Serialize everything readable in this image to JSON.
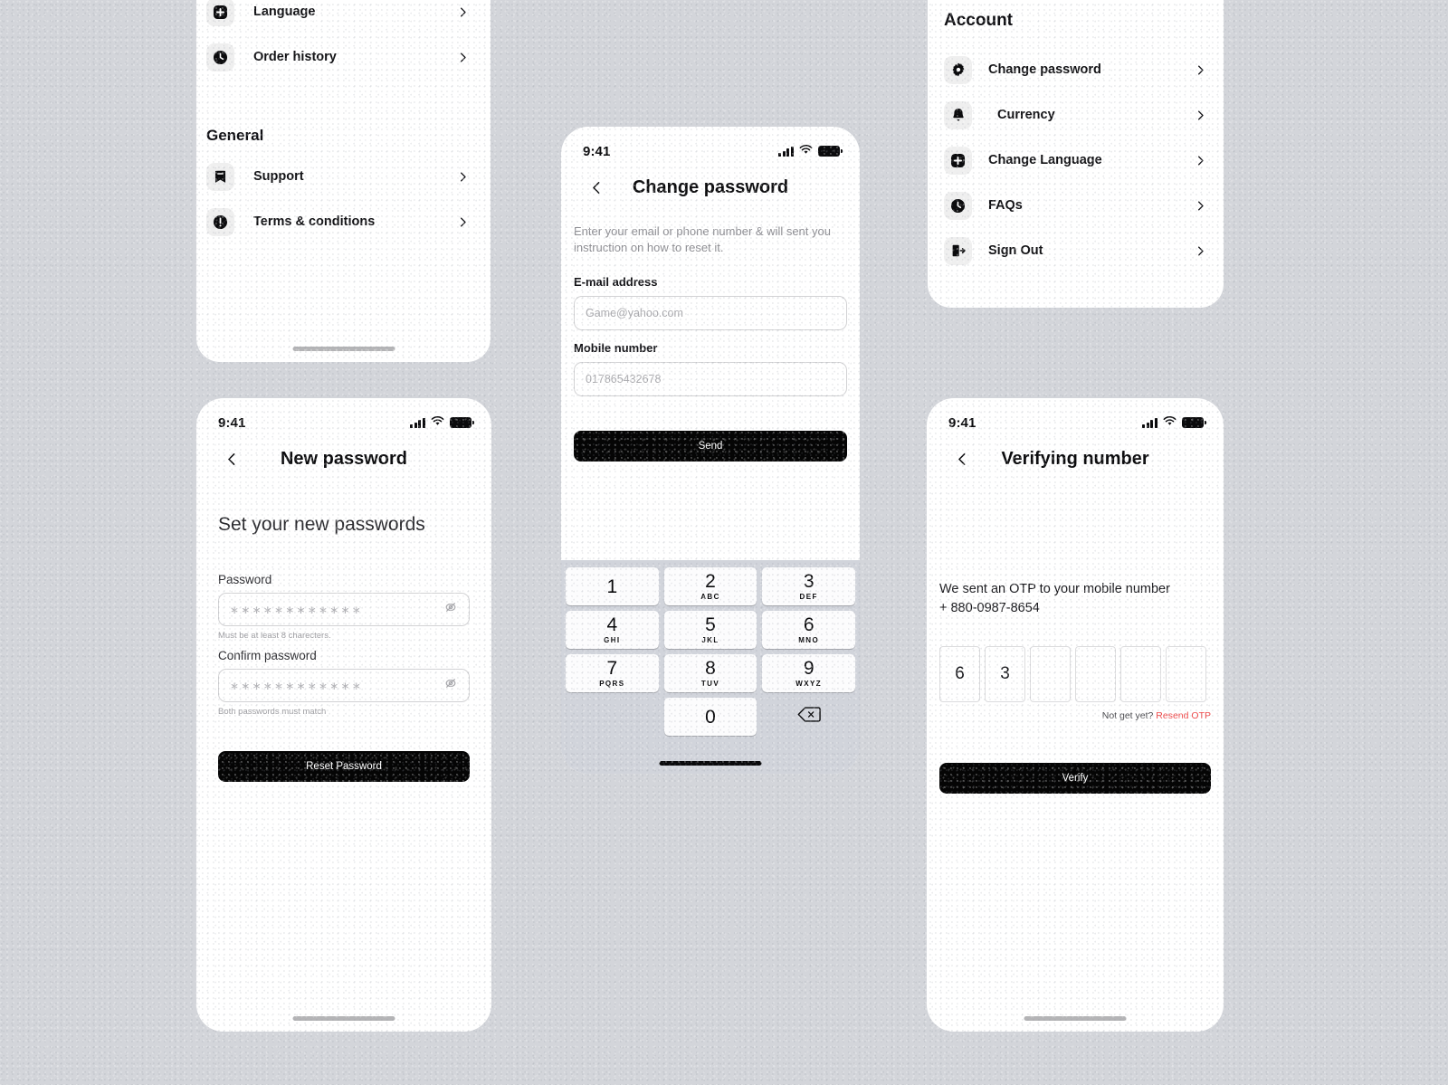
{
  "theme": {
    "background": "#d3d5da",
    "card": "#ffffff",
    "accent_dark": "#050505",
    "danger": "#f04a4a",
    "badge_bg": "#efefef",
    "keyboard_bg": "#d1d4db"
  },
  "settings_panel": {
    "top_items": [
      {
        "label": "Language",
        "icon": "plus-square-icon"
      },
      {
        "label": "Order history",
        "icon": "clock-icon"
      }
    ],
    "section_title": "General",
    "general_items": [
      {
        "label": "Support",
        "icon": "bookmark-icon"
      },
      {
        "label": "Terms & conditions",
        "icon": "alert-circle-icon"
      }
    ]
  },
  "account_panel": {
    "title": "Account",
    "items": [
      {
        "label": "Change password",
        "icon": "gear-icon"
      },
      {
        "label": "Currency",
        "icon": "bell-icon"
      },
      {
        "label": "Change Language",
        "icon": "plus-square-icon"
      },
      {
        "label": "FAQs",
        "icon": "clock-icon"
      },
      {
        "label": "Sign Out",
        "icon": "sign-out-icon"
      }
    ]
  },
  "status_bar": {
    "time": "9:41"
  },
  "change_password_screen": {
    "title": "Change password",
    "description": "Enter your email or phone number & will sent you instruction on how to reset it.",
    "email_label": "E-mail address",
    "email_placeholder": "Game@yahoo.com",
    "mobile_label": "Mobile number",
    "mobile_placeholder": "017865432678",
    "send_label": "Send",
    "keyboard": {
      "keys": [
        {
          "num": "1",
          "alpha": ""
        },
        {
          "num": "2",
          "alpha": "ABC"
        },
        {
          "num": "3",
          "alpha": "DEF"
        },
        {
          "num": "4",
          "alpha": "GHI"
        },
        {
          "num": "5",
          "alpha": "JKL"
        },
        {
          "num": "6",
          "alpha": "MNO"
        },
        {
          "num": "7",
          "alpha": "PQRS"
        },
        {
          "num": "8",
          "alpha": "TUV"
        },
        {
          "num": "9",
          "alpha": "WXYZ"
        }
      ],
      "zero": {
        "num": "0",
        "alpha": ""
      },
      "delete_icon": "backspace-icon"
    }
  },
  "new_password_screen": {
    "title": "New password",
    "heading": "Set your new passwords",
    "password_label": "Password",
    "password_value": "∗∗∗∗∗∗∗∗∗∗∗∗",
    "password_hint": "Must be at least 8 charecters.",
    "confirm_label": "Confirm password",
    "confirm_value": "∗∗∗∗∗∗∗∗∗∗∗∗",
    "confirm_hint": "Both passwords must match",
    "submit_label": "Reset Password",
    "reveal_icon": "eye-off-icon"
  },
  "verify_screen": {
    "title": "Verifying number",
    "message_line1": "We sent an OTP to your mobile number",
    "message_line2": "+ 880-0987-8654",
    "otp_digits": [
      "6",
      "3",
      "",
      "",
      "",
      ""
    ],
    "resend_prefix": "Not get yet? ",
    "resend_link": "Resend OTP",
    "verify_label": "Verify"
  }
}
